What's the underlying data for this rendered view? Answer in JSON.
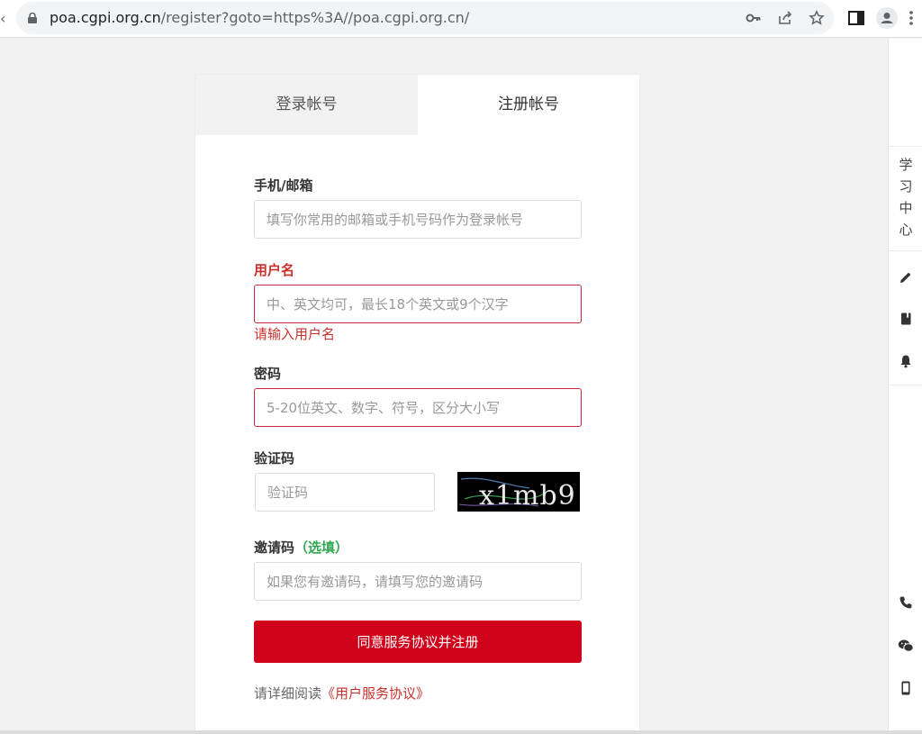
{
  "browser": {
    "url_host": "poa.cgpi.org.cn",
    "url_rest": "/register?goto=https%3A//poa.cgpi.org.cn/"
  },
  "tabs": {
    "login": "登录帐号",
    "register": "注册帐号"
  },
  "form": {
    "contact_label": "手机/邮箱",
    "contact_placeholder": "填写你常用的邮箱或手机号码作为登录帐号",
    "username_label": "用户名",
    "username_placeholder": "中、英文均可，最长18个英文或9个汉字",
    "username_error": "请输入用户名",
    "password_label": "密码",
    "password_placeholder": "5-20位英文、数字、符号，区分大小写",
    "captcha_label": "验证码",
    "captcha_placeholder": "验证码",
    "captcha_text": "x1mb9",
    "invite_label": "邀请码",
    "invite_optional": "（选填）",
    "invite_placeholder": "如果您有邀请码，请填写您的邀请码",
    "submit_label": "同意服务协议并注册",
    "agree_prefix": "请详细阅读",
    "agree_link": "《用户服务协议》"
  },
  "side": {
    "study_center": "学习中心"
  },
  "colors": {
    "accent": "#d0021b",
    "error": "#c9302c",
    "optional": "#33a852"
  }
}
